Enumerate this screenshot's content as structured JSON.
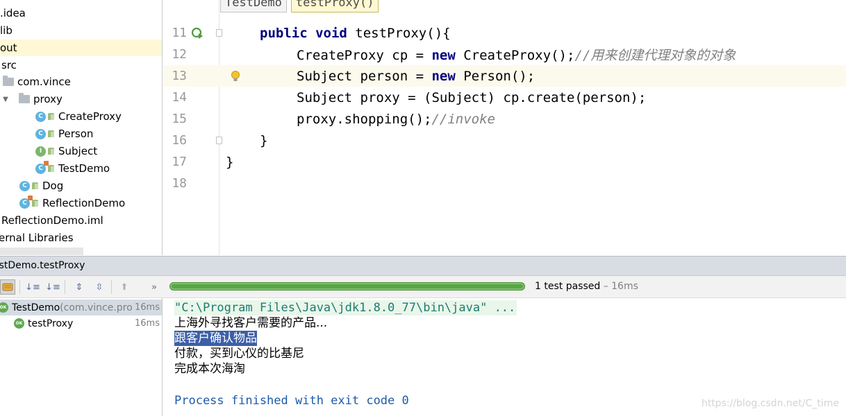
{
  "project_tree": {
    "items": [
      {
        "label": ".idea"
      },
      {
        "label": "lib"
      },
      {
        "label": "out"
      },
      {
        "label": "src"
      },
      {
        "label": "com.vince"
      },
      {
        "label": "proxy"
      },
      {
        "label": "CreateProxy",
        "icon": "C"
      },
      {
        "label": "Person",
        "icon": "C"
      },
      {
        "label": "Subject",
        "icon": "I"
      },
      {
        "label": "TestDemo",
        "icon": "C"
      },
      {
        "label": "Dog",
        "icon": "C"
      },
      {
        "label": "ReflectionDemo",
        "icon": "C"
      },
      {
        "label": "ReflectionDemo.iml"
      },
      {
        "label": "ernal Libraries"
      }
    ]
  },
  "editor": {
    "tabs": [
      {
        "label": "TestDemo"
      },
      {
        "label": "testProxy()"
      }
    ],
    "line_numbers": [
      "11",
      "12",
      "13",
      "14",
      "15",
      "16",
      "17",
      "18"
    ],
    "code": {
      "l11_kw1": "public",
      "l11_kw2": "void",
      "l11_rest": " testProxy(){",
      "l12_a": "CreateProxy cp = ",
      "l12_kw": "new",
      "l12_b": " CreateProxy();",
      "l12_comment": "//用来创建代理对象的对象",
      "l13_a": "Subject person = ",
      "l13_kw": "new",
      "l13_b": " Person();",
      "l14": "Subject proxy = (Subject) cp.create(person);",
      "l15_a": "proxy.shopping();",
      "l15_comment": "//invoke",
      "l16": "}",
      "l17": "}"
    }
  },
  "run_panel": {
    "title": "estDemo.testProxy",
    "progress": 1.0,
    "status_text": "1 test passed",
    "status_time": " – 16ms",
    "tests": [
      {
        "name": "TestDemo",
        "package": " (com.vince.pro",
        "time": "16ms",
        "badge": "OK"
      },
      {
        "name": "testProxy",
        "time": "16ms",
        "badge": "OK"
      }
    ],
    "console_lines": {
      "cmd": "\"C:\\Program Files\\Java\\jdk1.8.0_77\\bin\\java\" ...",
      "out1": "上海外寻找客户需要的产品...",
      "out2": "跟客户确认物品",
      "out3": "付款，买到心仪的比基尼",
      "out4": "完成本次海淘",
      "exit": "Process finished with exit code 0"
    }
  },
  "watermark": "https://blog.csdn.net/C_time",
  "colors": {
    "keyword": "#000080",
    "comment": "#808080",
    "progress": "#5aa646",
    "console_command": "#1e7b6f",
    "console_exit": "#1e5aa8",
    "selection": "#3d5fa8"
  }
}
